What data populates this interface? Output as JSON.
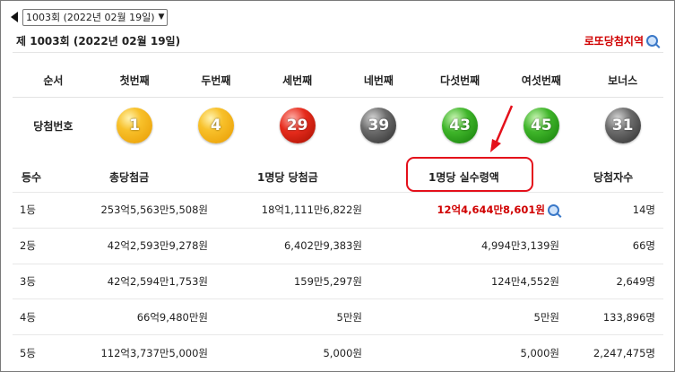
{
  "nav": {
    "round_select_value": "1003회 (2022년 02월 19일)"
  },
  "header": {
    "title": "제 1003회 (2022년 02월 19일)",
    "region_link": "로또당첨지역"
  },
  "balls": {
    "headers": [
      "순서",
      "첫번째",
      "두번째",
      "세번째",
      "네번째",
      "다섯번째",
      "여섯번째",
      "보너스"
    ],
    "row_label": "당첨번호",
    "numbers": [
      {
        "value": "1",
        "color": "yellow"
      },
      {
        "value": "4",
        "color": "yellow"
      },
      {
        "value": "29",
        "color": "red"
      },
      {
        "value": "39",
        "color": "gray"
      },
      {
        "value": "43",
        "color": "green"
      },
      {
        "value": "45",
        "color": "green"
      },
      {
        "value": "31",
        "color": "gray"
      }
    ]
  },
  "prizes": {
    "headers": [
      "등수",
      "총당첨금",
      "1명당 당첨금",
      "1명당 실수령액",
      "당첨자수"
    ],
    "rows": [
      {
        "rank": "1등",
        "total": "253억5,563만5,508원",
        "per_person": "18억1,111만6,822원",
        "net": "12억4,644만8,601원",
        "winners": "14명"
      },
      {
        "rank": "2등",
        "total": "42억2,593만9,278원",
        "per_person": "6,402만9,383원",
        "net": "4,994만3,139원",
        "winners": "66명"
      },
      {
        "rank": "3등",
        "total": "42억2,594만1,753원",
        "per_person": "159만5,297원",
        "net": "124만4,552원",
        "winners": "2,649명"
      },
      {
        "rank": "4등",
        "total": "66억9,480만원",
        "per_person": "5만원",
        "net": "5만원",
        "winners": "133,896명"
      },
      {
        "rank": "5등",
        "total": "112억3,737만5,000원",
        "per_person": "5,000원",
        "net": "5,000원",
        "winners": "2,247,475명"
      }
    ]
  },
  "colors": {
    "accent_red": "#d00000",
    "annotation_red": "#e4101b"
  }
}
